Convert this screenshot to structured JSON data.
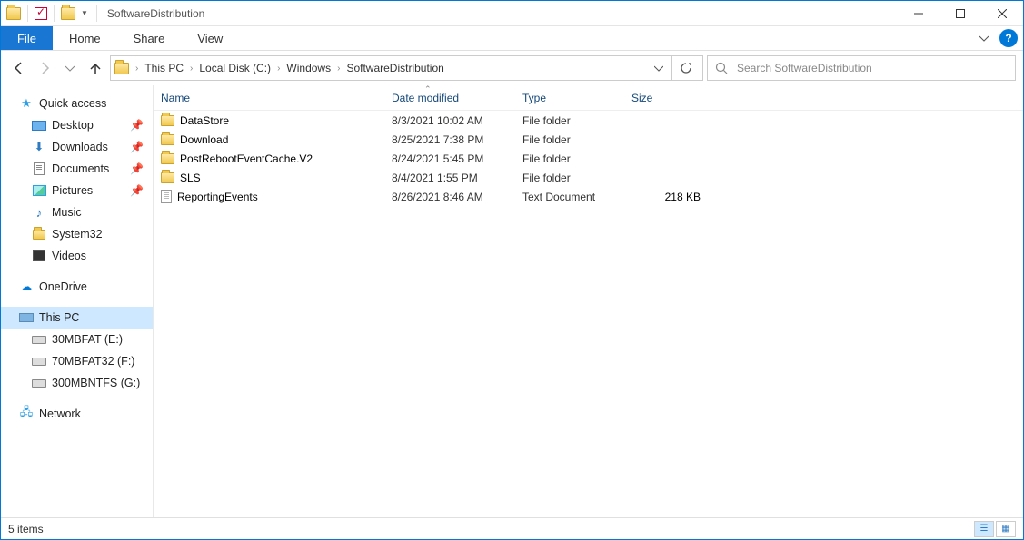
{
  "titlebar": {
    "title": "SoftwareDistribution"
  },
  "ribbon": {
    "file": "File",
    "tabs": [
      "Home",
      "Share",
      "View"
    ]
  },
  "breadcrumbs": [
    "This PC",
    "Local Disk (C:)",
    "Windows",
    "SoftwareDistribution"
  ],
  "search": {
    "placeholder": "Search SoftwareDistribution"
  },
  "tree": {
    "quick_access": "Quick access",
    "quick_items": [
      {
        "label": "Desktop",
        "pinned": true,
        "icon": "desktop"
      },
      {
        "label": "Downloads",
        "pinned": true,
        "icon": "download"
      },
      {
        "label": "Documents",
        "pinned": true,
        "icon": "document"
      },
      {
        "label": "Pictures",
        "pinned": true,
        "icon": "picture"
      },
      {
        "label": "Music",
        "pinned": false,
        "icon": "music"
      },
      {
        "label": "System32",
        "pinned": false,
        "icon": "folder"
      },
      {
        "label": "Videos",
        "pinned": false,
        "icon": "video"
      }
    ],
    "onedrive": "OneDrive",
    "this_pc": "This PC",
    "drives": [
      {
        "label": "30MBFAT (E:)"
      },
      {
        "label": "70MBFAT32 (F:)"
      },
      {
        "label": "300MBNTFS (G:)"
      }
    ],
    "network": "Network"
  },
  "columns": {
    "name": "Name",
    "date": "Date modified",
    "type": "Type",
    "size": "Size"
  },
  "items": [
    {
      "name": "DataStore",
      "date": "8/3/2021 10:02 AM",
      "type": "File folder",
      "size": "",
      "kind": "folder"
    },
    {
      "name": "Download",
      "date": "8/25/2021 7:38 PM",
      "type": "File folder",
      "size": "",
      "kind": "folder"
    },
    {
      "name": "PostRebootEventCache.V2",
      "date": "8/24/2021 5:45 PM",
      "type": "File folder",
      "size": "",
      "kind": "folder"
    },
    {
      "name": "SLS",
      "date": "8/4/2021 1:55 PM",
      "type": "File folder",
      "size": "",
      "kind": "folder"
    },
    {
      "name": "ReportingEvents",
      "date": "8/26/2021 8:46 AM",
      "type": "Text Document",
      "size": "218 KB",
      "kind": "file"
    }
  ],
  "status": {
    "count": "5 items"
  }
}
